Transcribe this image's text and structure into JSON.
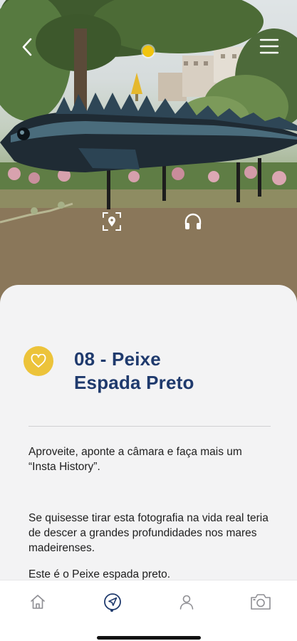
{
  "scene": {
    "photo_subject": "",
    "top_bar": {
      "back_icon": "chevron-left-icon",
      "menu_icon": "hamburger-menu-icon",
      "coin_color": "#f1c40f"
    },
    "overlay_actions": {
      "ar_icon": "ar-location-scan-icon",
      "audio_icon": "headphones-icon"
    }
  },
  "card": {
    "favorite_icon": "heart-icon",
    "favorite_color": "#ecc33a",
    "title_line1": "08 - Peixe",
    "title_line2": "Espada Preto",
    "paragraph1": "Aproveite, aponte a câmara e faça mais um “Insta History”.",
    "paragraph2": "Se quisesse tirar esta fotografia na vida real teria de descer a grandes profundidades nos mares madeirenses.",
    "paragraph3": "Este é o Peixe espada preto."
  },
  "tabbar": {
    "active_tab": "explore",
    "accent_color": "#1f3a6d",
    "items": [
      {
        "id": "home",
        "icon": "home-icon"
      },
      {
        "id": "explore",
        "icon": "navigation-arrow-icon"
      },
      {
        "id": "profile",
        "icon": "user-icon"
      },
      {
        "id": "camera",
        "icon": "camera-icon"
      }
    ]
  }
}
